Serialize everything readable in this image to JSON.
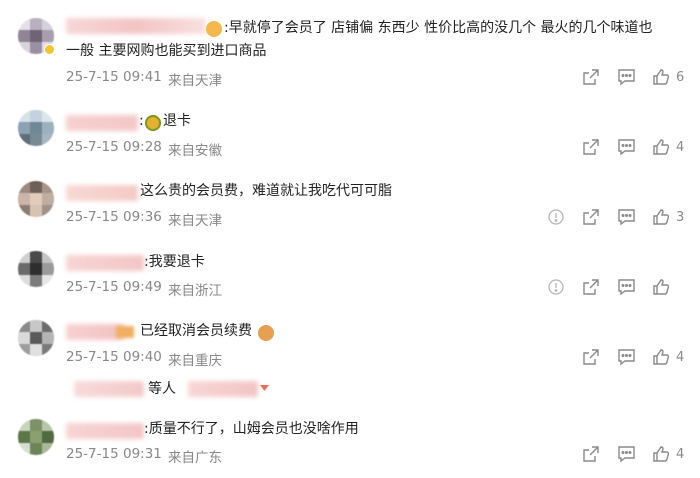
{
  "comments": [
    {
      "text_line1": ":早就停了会员了  店铺偏 东西少 性价比高的没几个  最火的几个味道也",
      "text_line2": "一般    主要网购也能买到进口商品",
      "date": "25-7-15 09:41",
      "location": "来自天津",
      "likes": "6",
      "emoji_icon": "smirk-emoji-icon"
    },
    {
      "text_line1": "退卡",
      "date": "25-7-15 09:28",
      "location": "来自安徽",
      "likes": "4",
      "emoji_icon": "angry-emoji-icon"
    },
    {
      "text_line1": "这么贵的会员费，难道就让我吃代可可脂",
      "date": "25-7-15 09:36",
      "location": "来自天津",
      "likes": "3"
    },
    {
      "text_line1": ":我要退卡",
      "date": "25-7-15 09:49",
      "location": "来自浙江",
      "likes": ""
    },
    {
      "text_line1": "已经取消会员续费",
      "date": "25-7-15 09:40",
      "location": "来自重庆",
      "likes": "4",
      "emoji_icon": "cat-emoji-icon"
    },
    {
      "text_line1": ":质量不行了，山姆会员也没啥作用",
      "date": "25-7-15 09:31",
      "location": "来自广东",
      "likes": "4"
    }
  ],
  "reply_summary": {
    "label": "等人"
  },
  "colors": {
    "meta": "#888888",
    "icon": "#8a8a8a",
    "text": "#222222"
  }
}
